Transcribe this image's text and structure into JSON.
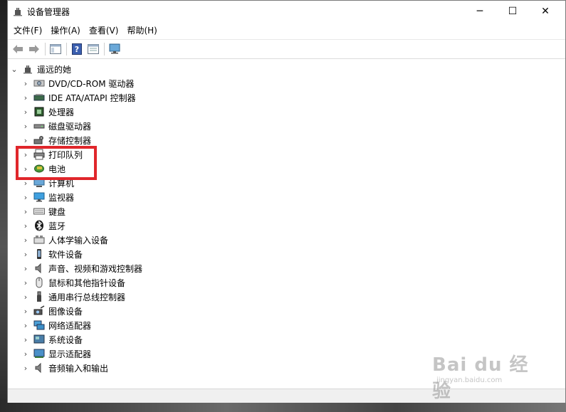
{
  "window": {
    "title": "设备管理器",
    "minimize": "─",
    "maximize": "☐",
    "close": "✕"
  },
  "menu": [
    "文件(F)",
    "操作(A)",
    "查看(V)",
    "帮助(H)"
  ],
  "toolbar": {
    "buttons": [
      "back-icon",
      "forward-icon",
      "show-hide-console-tree-icon",
      "help-icon",
      "properties-icon",
      "scan-hardware-icon"
    ]
  },
  "tree": {
    "root": {
      "label": "遥远的她",
      "expanded": true
    },
    "items": [
      {
        "label": "DVD/CD-ROM 驱动器",
        "icon": "dvd-drive-icon"
      },
      {
        "label": "IDE ATA/ATAPI 控制器",
        "icon": "ide-controller-icon"
      },
      {
        "label": "处理器",
        "icon": "processor-icon"
      },
      {
        "label": "磁盘驱动器",
        "icon": "disk-drive-icon"
      },
      {
        "label": "存储控制器",
        "icon": "storage-controller-icon"
      },
      {
        "label": "打印队列",
        "icon": "printer-icon"
      },
      {
        "label": "电池",
        "icon": "battery-icon"
      },
      {
        "label": "计算机",
        "icon": "computer-icon"
      },
      {
        "label": "监视器",
        "icon": "monitor-icon"
      },
      {
        "label": "键盘",
        "icon": "keyboard-icon"
      },
      {
        "label": "蓝牙",
        "icon": "bluetooth-icon"
      },
      {
        "label": "人体学输入设备",
        "icon": "hid-icon"
      },
      {
        "label": "软件设备",
        "icon": "software-device-icon"
      },
      {
        "label": "声音、视频和游戏控制器",
        "icon": "speaker-icon"
      },
      {
        "label": "鼠标和其他指针设备",
        "icon": "mouse-icon"
      },
      {
        "label": "通用串行总线控制器",
        "icon": "usb-icon"
      },
      {
        "label": "图像设备",
        "icon": "camera-icon"
      },
      {
        "label": "网络适配器",
        "icon": "network-adapter-icon"
      },
      {
        "label": "系统设备",
        "icon": "system-device-icon"
      },
      {
        "label": "显示适配器",
        "icon": "display-adapter-icon"
      },
      {
        "label": "音频输入和输出",
        "icon": "audio-io-icon"
      }
    ]
  },
  "watermark": {
    "logo": "Bai du 经验",
    "sub": "jingyan.baidu.com"
  },
  "colors": {
    "highlight": "#e0262b",
    "window_bg": "#ffffff",
    "statusbar_bg": "#f0f0f0"
  }
}
